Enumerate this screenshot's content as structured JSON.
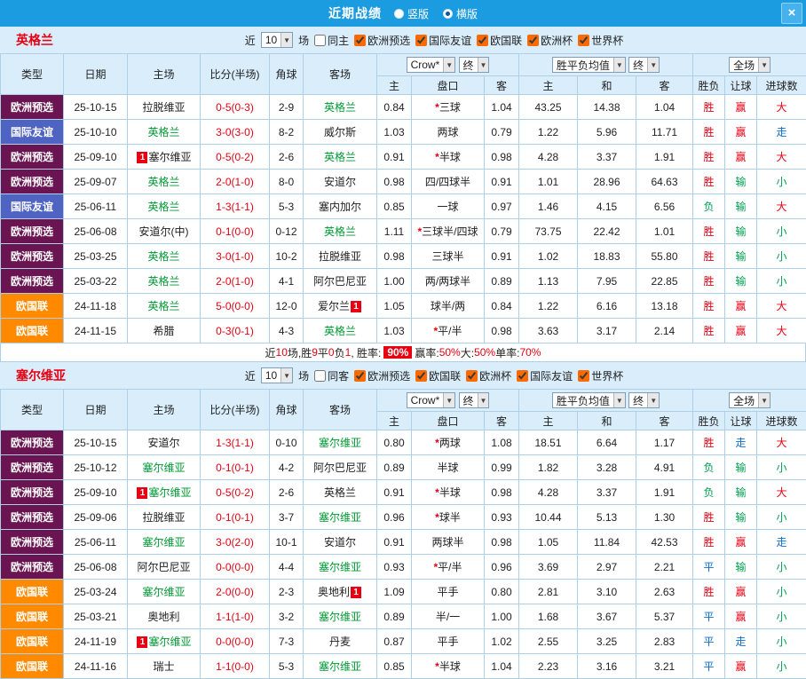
{
  "titlebar": {
    "title": "近期战绩",
    "radio_vertical": "竖版",
    "radio_horizontal": "横版",
    "close": "×"
  },
  "columns": {
    "type": "类型",
    "date": "日期",
    "home": "主场",
    "score": "比分(半场)",
    "corner": "角球",
    "away": "客场",
    "h": "主",
    "handicap": "盘口",
    "a": "客",
    "d": "和",
    "result": "胜负",
    "handicap_result": "让球",
    "goals": "进球数"
  },
  "controls": {
    "near": "近",
    "count": "10",
    "games": "场",
    "odds_source": "Crow*",
    "final": "终",
    "avg": "胜平负均值",
    "scope": "全场"
  },
  "badge_text": "1",
  "colors": {
    "accent_blue": "#1b9be0",
    "panel_blue": "#d9edfb",
    "grid_blue": "#aecfe8",
    "red": "#e60012",
    "green": "#00a050",
    "blue": "#0b6fd0",
    "team_green": "#009933"
  },
  "type_colors": {
    "欧洲预选": "#6b1452",
    "国际友谊": "#4f63c3",
    "欧国联": "#ff8a00"
  },
  "result_colors": {
    "胜": "#e60012",
    "负": "#00a050",
    "平": "#0b6fd0",
    "赢": "#e60012",
    "输": "#00a050",
    "走": "#0b6fd0",
    "大": "#e60012",
    "小": "#00a050"
  },
  "sections": [
    {
      "team": "英格兰",
      "same_label": "同主",
      "filters": [
        "欧洲预选",
        "国际友谊",
        "欧国联",
        "欧洲杯",
        "世界杯"
      ],
      "rows": [
        {
          "type": "欧洲预选",
          "date": "25-10-15",
          "home": "拉脱维亚",
          "home_hl": false,
          "home_badge": false,
          "score": "0-5(0-3)",
          "corner": "2-9",
          "away": "英格兰",
          "away_hl": true,
          "away_badge": false,
          "h_odds": "0.84",
          "line": "*三球",
          "a_odds": "1.04",
          "win": "43.25",
          "draw": "14.38",
          "lose": "1.04",
          "res": "胜",
          "hcp": "赢",
          "goals": "大"
        },
        {
          "type": "国际友谊",
          "date": "25-10-10",
          "home": "英格兰",
          "home_hl": true,
          "home_badge": false,
          "score": "3-0(3-0)",
          "corner": "8-2",
          "away": "威尔斯",
          "away_hl": false,
          "away_badge": false,
          "h_odds": "1.03",
          "line": "两球",
          "a_odds": "0.79",
          "win": "1.22",
          "draw": "5.96",
          "lose": "11.71",
          "res": "胜",
          "hcp": "赢",
          "goals": "走"
        },
        {
          "type": "欧洲预选",
          "date": "25-09-10",
          "home": "塞尔维亚",
          "home_hl": false,
          "home_badge": true,
          "score": "0-5(0-2)",
          "corner": "2-6",
          "away": "英格兰",
          "away_hl": true,
          "away_badge": false,
          "h_odds": "0.91",
          "line": "*半球",
          "a_odds": "0.98",
          "win": "4.28",
          "draw": "3.37",
          "lose": "1.91",
          "res": "胜",
          "hcp": "赢",
          "goals": "大"
        },
        {
          "type": "欧洲预选",
          "date": "25-09-07",
          "home": "英格兰",
          "home_hl": true,
          "home_badge": false,
          "score": "2-0(1-0)",
          "corner": "8-0",
          "away": "安道尔",
          "away_hl": false,
          "away_badge": false,
          "h_odds": "0.98",
          "line": "四/四球半",
          "a_odds": "0.91",
          "win": "1.01",
          "draw": "28.96",
          "lose": "64.63",
          "res": "胜",
          "hcp": "输",
          "goals": "小"
        },
        {
          "type": "国际友谊",
          "date": "25-06-11",
          "home": "英格兰",
          "home_hl": true,
          "home_badge": false,
          "score": "1-3(1-1)",
          "corner": "5-3",
          "away": "塞内加尔",
          "away_hl": false,
          "away_badge": false,
          "h_odds": "0.85",
          "line": "一球",
          "a_odds": "0.97",
          "win": "1.46",
          "draw": "4.15",
          "lose": "6.56",
          "res": "负",
          "hcp": "输",
          "goals": "大"
        },
        {
          "type": "欧洲预选",
          "date": "25-06-08",
          "home": "安道尔(中)",
          "home_hl": false,
          "home_badge": false,
          "score": "0-1(0-0)",
          "corner": "0-12",
          "away": "英格兰",
          "away_hl": true,
          "away_badge": false,
          "h_odds": "1.11",
          "line": "*三球半/四球",
          "a_odds": "0.79",
          "win": "73.75",
          "draw": "22.42",
          "lose": "1.01",
          "res": "胜",
          "hcp": "输",
          "goals": "小"
        },
        {
          "type": "欧洲预选",
          "date": "25-03-25",
          "home": "英格兰",
          "home_hl": true,
          "home_badge": false,
          "score": "3-0(1-0)",
          "corner": "10-2",
          "away": "拉脱维亚",
          "away_hl": false,
          "away_badge": false,
          "h_odds": "0.98",
          "line": "三球半",
          "a_odds": "0.91",
          "win": "1.02",
          "draw": "18.83",
          "lose": "55.80",
          "res": "胜",
          "hcp": "输",
          "goals": "小"
        },
        {
          "type": "欧洲预选",
          "date": "25-03-22",
          "home": "英格兰",
          "home_hl": true,
          "home_badge": false,
          "score": "2-0(1-0)",
          "corner": "4-1",
          "away": "阿尔巴尼亚",
          "away_hl": false,
          "away_badge": false,
          "h_odds": "1.00",
          "line": "两/两球半",
          "a_odds": "0.89",
          "win": "1.13",
          "draw": "7.95",
          "lose": "22.85",
          "res": "胜",
          "hcp": "输",
          "goals": "小"
        },
        {
          "type": "欧国联",
          "date": "24-11-18",
          "home": "英格兰",
          "home_hl": true,
          "home_badge": false,
          "score": "5-0(0-0)",
          "corner": "12-0",
          "away": "爱尔兰",
          "away_hl": false,
          "away_badge": true,
          "h_odds": "1.05",
          "line": "球半/两",
          "a_odds": "0.84",
          "win": "1.22",
          "draw": "6.16",
          "lose": "13.18",
          "res": "胜",
          "hcp": "赢",
          "goals": "大"
        },
        {
          "type": "欧国联",
          "date": "24-11-15",
          "home": "希腊",
          "home_hl": false,
          "home_badge": false,
          "score": "0-3(0-1)",
          "corner": "4-3",
          "away": "英格兰",
          "away_hl": true,
          "away_badge": false,
          "h_odds": "1.03",
          "line": "*平/半",
          "a_odds": "0.98",
          "win": "3.63",
          "draw": "3.17",
          "lose": "2.14",
          "res": "胜",
          "hcp": "赢",
          "goals": "大"
        }
      ],
      "summary": [
        {
          "text": "近",
          "style": "plain"
        },
        {
          "text": "10",
          "style": "red"
        },
        {
          "text": "场,胜",
          "style": "plain"
        },
        {
          "text": "9",
          "style": "red"
        },
        {
          "text": "平",
          "style": "plain"
        },
        {
          "text": "0",
          "style": "red"
        },
        {
          "text": "负",
          "style": "plain"
        },
        {
          "text": "1",
          "style": "red"
        },
        {
          "text": ", 胜率: ",
          "style": "plain"
        },
        {
          "text": "90%",
          "style": "badge"
        },
        {
          "text": " 赢率:",
          "style": "plain"
        },
        {
          "text": "50%",
          "style": "red"
        },
        {
          "text": " 大:",
          "style": "plain"
        },
        {
          "text": "50%",
          "style": "red"
        },
        {
          "text": " 单率:",
          "style": "plain"
        },
        {
          "text": "70%",
          "style": "red"
        }
      ]
    },
    {
      "team": "塞尔维亚",
      "same_label": "同客",
      "filters": [
        "欧洲预选",
        "欧国联",
        "欧洲杯",
        "国际友谊",
        "世界杯"
      ],
      "rows": [
        {
          "type": "欧洲预选",
          "date": "25-10-15",
          "home": "安道尔",
          "home_hl": false,
          "home_badge": false,
          "score": "1-3(1-1)",
          "corner": "0-10",
          "away": "塞尔维亚",
          "away_hl": true,
          "away_badge": false,
          "h_odds": "0.80",
          "line": "*两球",
          "a_odds": "1.08",
          "win": "18.51",
          "draw": "6.64",
          "lose": "1.17",
          "res": "胜",
          "hcp": "走",
          "goals": "大"
        },
        {
          "type": "欧洲预选",
          "date": "25-10-12",
          "home": "塞尔维亚",
          "home_hl": true,
          "home_badge": false,
          "score": "0-1(0-1)",
          "corner": "4-2",
          "away": "阿尔巴尼亚",
          "away_hl": false,
          "away_badge": false,
          "h_odds": "0.89",
          "line": "半球",
          "a_odds": "0.99",
          "win": "1.82",
          "draw": "3.28",
          "lose": "4.91",
          "res": "负",
          "hcp": "输",
          "goals": "小"
        },
        {
          "type": "欧洲预选",
          "date": "25-09-10",
          "home": "塞尔维亚",
          "home_hl": true,
          "home_badge": true,
          "score": "0-5(0-2)",
          "corner": "2-6",
          "away": "英格兰",
          "away_hl": false,
          "away_badge": false,
          "h_odds": "0.91",
          "line": "*半球",
          "a_odds": "0.98",
          "win": "4.28",
          "draw": "3.37",
          "lose": "1.91",
          "res": "负",
          "hcp": "输",
          "goals": "大"
        },
        {
          "type": "欧洲预选",
          "date": "25-09-06",
          "home": "拉脱维亚",
          "home_hl": false,
          "home_badge": false,
          "score": "0-1(0-1)",
          "corner": "3-7",
          "away": "塞尔维亚",
          "away_hl": true,
          "away_badge": false,
          "h_odds": "0.96",
          "line": "*球半",
          "a_odds": "0.93",
          "win": "10.44",
          "draw": "5.13",
          "lose": "1.30",
          "res": "胜",
          "hcp": "输",
          "goals": "小"
        },
        {
          "type": "欧洲预选",
          "date": "25-06-11",
          "home": "塞尔维亚",
          "home_hl": true,
          "home_badge": false,
          "score": "3-0(2-0)",
          "corner": "10-1",
          "away": "安道尔",
          "away_hl": false,
          "away_badge": false,
          "h_odds": "0.91",
          "line": "两球半",
          "a_odds": "0.98",
          "win": "1.05",
          "draw": "11.84",
          "lose": "42.53",
          "res": "胜",
          "hcp": "赢",
          "goals": "走"
        },
        {
          "type": "欧洲预选",
          "date": "25-06-08",
          "home": "阿尔巴尼亚",
          "home_hl": false,
          "home_badge": false,
          "score": "0-0(0-0)",
          "corner": "4-4",
          "away": "塞尔维亚",
          "away_hl": true,
          "away_badge": false,
          "h_odds": "0.93",
          "line": "*平/半",
          "a_odds": "0.96",
          "win": "3.69",
          "draw": "2.97",
          "lose": "2.21",
          "res": "平",
          "hcp": "输",
          "goals": "小"
        },
        {
          "type": "欧国联",
          "date": "25-03-24",
          "home": "塞尔维亚",
          "home_hl": true,
          "home_badge": false,
          "score": "2-0(0-0)",
          "corner": "2-3",
          "away": "奥地利",
          "away_hl": false,
          "away_badge": true,
          "h_odds": "1.09",
          "line": "平手",
          "a_odds": "0.80",
          "win": "2.81",
          "draw": "3.10",
          "lose": "2.63",
          "res": "胜",
          "hcp": "赢",
          "goals": "小"
        },
        {
          "type": "欧国联",
          "date": "25-03-21",
          "home": "奥地利",
          "home_hl": false,
          "home_badge": false,
          "score": "1-1(1-0)",
          "corner": "3-2",
          "away": "塞尔维亚",
          "away_hl": true,
          "away_badge": false,
          "h_odds": "0.89",
          "line": "半/一",
          "a_odds": "1.00",
          "win": "1.68",
          "draw": "3.67",
          "lose": "5.37",
          "res": "平",
          "hcp": "赢",
          "goals": "小"
        },
        {
          "type": "欧国联",
          "date": "24-11-19",
          "home": "塞尔维亚",
          "home_hl": true,
          "home_badge": true,
          "score": "0-0(0-0)",
          "corner": "7-3",
          "away": "丹麦",
          "away_hl": false,
          "away_badge": false,
          "h_odds": "0.87",
          "line": "平手",
          "a_odds": "1.02",
          "win": "2.55",
          "draw": "3.25",
          "lose": "2.83",
          "res": "平",
          "hcp": "走",
          "goals": "小"
        },
        {
          "type": "欧国联",
          "date": "24-11-16",
          "home": "瑞士",
          "home_hl": false,
          "home_badge": false,
          "score": "1-1(0-0)",
          "corner": "5-3",
          "away": "塞尔维亚",
          "away_hl": true,
          "away_badge": false,
          "h_odds": "0.85",
          "line": "*半球",
          "a_odds": "1.04",
          "win": "2.23",
          "draw": "3.16",
          "lose": "3.21",
          "res": "平",
          "hcp": "赢",
          "goals": "小"
        }
      ],
      "summary": []
    }
  ]
}
